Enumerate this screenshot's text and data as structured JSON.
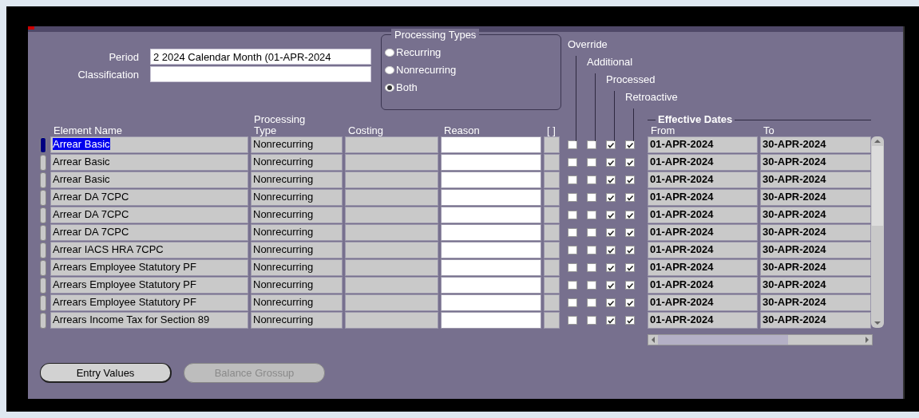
{
  "period": {
    "label": "Period",
    "value": "2 2024 Calendar Month (01-APR-2024"
  },
  "classification": {
    "label": "Classification"
  },
  "processing_types": {
    "title": "Processing Types",
    "options": [
      {
        "label": "Recurring",
        "selected": false
      },
      {
        "label": "Nonrecurring",
        "selected": false
      },
      {
        "label": "Both",
        "selected": true
      }
    ]
  },
  "flag_columns": [
    "Override",
    "Additional",
    "Processed",
    "Retroactive"
  ],
  "columns": {
    "element_name": "Element Name",
    "processing_type": "Processing Type",
    "costing": "Costing",
    "reason": "Reason",
    "flex": "[ ]"
  },
  "effective_dates": {
    "title": "Effective Dates",
    "from": "From",
    "to": "To"
  },
  "rows": [
    {
      "element_name": "Arrear Basic",
      "processing_type": "Nonrecurring",
      "flags": [
        false,
        false,
        true,
        true
      ],
      "from": "01-APR-2024",
      "to": "30-APR-2024",
      "selected": true
    },
    {
      "element_name": "Arrear Basic",
      "processing_type": "Nonrecurring",
      "flags": [
        false,
        false,
        true,
        true
      ],
      "from": "01-APR-2024",
      "to": "30-APR-2024",
      "selected": false
    },
    {
      "element_name": "Arrear Basic",
      "processing_type": "Nonrecurring",
      "flags": [
        false,
        false,
        true,
        true
      ],
      "from": "01-APR-2024",
      "to": "30-APR-2024",
      "selected": false
    },
    {
      "element_name": "Arrear DA 7CPC",
      "processing_type": "Nonrecurring",
      "flags": [
        false,
        false,
        true,
        true
      ],
      "from": "01-APR-2024",
      "to": "30-APR-2024",
      "selected": false
    },
    {
      "element_name": "Arrear DA 7CPC",
      "processing_type": "Nonrecurring",
      "flags": [
        false,
        false,
        true,
        true
      ],
      "from": "01-APR-2024",
      "to": "30-APR-2024",
      "selected": false
    },
    {
      "element_name": "Arrear DA 7CPC",
      "processing_type": "Nonrecurring",
      "flags": [
        false,
        false,
        true,
        true
      ],
      "from": "01-APR-2024",
      "to": "30-APR-2024",
      "selected": false
    },
    {
      "element_name": "Arrear IACS HRA 7CPC",
      "processing_type": "Nonrecurring",
      "flags": [
        false,
        false,
        true,
        true
      ],
      "from": "01-APR-2024",
      "to": "30-APR-2024",
      "selected": false
    },
    {
      "element_name": "Arrears Employee Statutory PF",
      "processing_type": "Nonrecurring",
      "flags": [
        false,
        false,
        true,
        true
      ],
      "from": "01-APR-2024",
      "to": "30-APR-2024",
      "selected": false
    },
    {
      "element_name": "Arrears Employee Statutory PF",
      "processing_type": "Nonrecurring",
      "flags": [
        false,
        false,
        true,
        true
      ],
      "from": "01-APR-2024",
      "to": "30-APR-2024",
      "selected": false
    },
    {
      "element_name": "Arrears Employee Statutory PF",
      "processing_type": "Nonrecurring",
      "flags": [
        false,
        false,
        true,
        true
      ],
      "from": "01-APR-2024",
      "to": "30-APR-2024",
      "selected": false
    },
    {
      "element_name": "Arrears Income Tax for Section 89",
      "processing_type": "Nonrecurring",
      "flags": [
        false,
        false,
        true,
        true
      ],
      "from": "01-APR-2024",
      "to": "30-APR-2024",
      "selected": false
    }
  ],
  "buttons": [
    {
      "label": "Entry Values",
      "disabled": false
    },
    {
      "label": "Balance Grossup",
      "disabled": true
    }
  ]
}
